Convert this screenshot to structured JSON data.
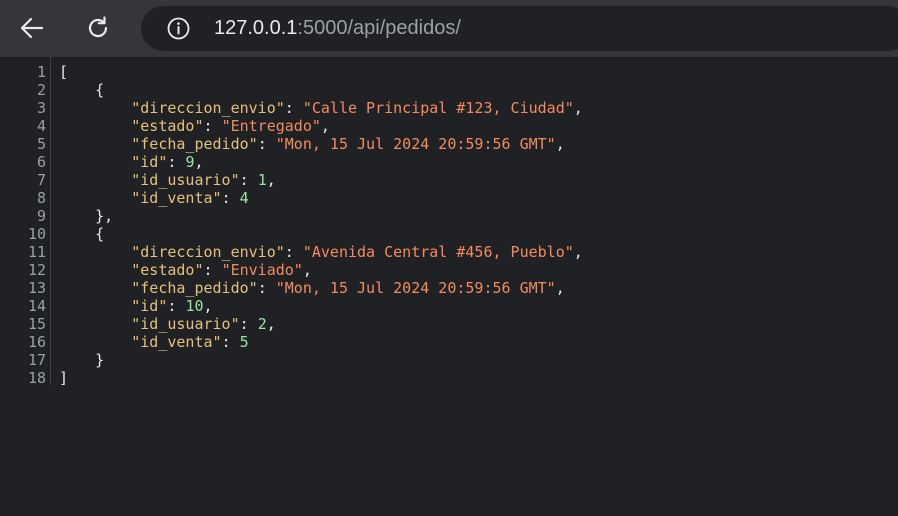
{
  "browser": {
    "url_host": "127.0.0.1",
    "url_path": ":5000/api/pedidos/"
  },
  "icons": {
    "back": "arrow-back-icon",
    "reload": "reload-icon",
    "info": "info-icon"
  },
  "colors": {
    "toolbar": "#35363a",
    "background": "#202124",
    "key": "#e5c07b",
    "string": "#f28b60",
    "number": "#98e6a5",
    "punctuation": "#e8eaed",
    "line_number": "#9aa0a6"
  },
  "code": {
    "lines": [
      {
        "n": "1",
        "indent": "",
        "tokens": [
          {
            "t": "[",
            "c": "p"
          }
        ]
      },
      {
        "n": "2",
        "indent": "    ",
        "tokens": [
          {
            "t": "{",
            "c": "p"
          }
        ]
      },
      {
        "n": "3",
        "indent": "        ",
        "tokens": [
          {
            "t": "\"direccion_envio\"",
            "c": "k"
          },
          {
            "t": ": ",
            "c": "p"
          },
          {
            "t": "\"Calle Principal #123, Ciudad\"",
            "c": "s"
          },
          {
            "t": ",",
            "c": "p"
          }
        ]
      },
      {
        "n": "4",
        "indent": "        ",
        "tokens": [
          {
            "t": "\"estado\"",
            "c": "k"
          },
          {
            "t": ": ",
            "c": "p"
          },
          {
            "t": "\"Entregado\"",
            "c": "s"
          },
          {
            "t": ",",
            "c": "p"
          }
        ]
      },
      {
        "n": "5",
        "indent": "        ",
        "tokens": [
          {
            "t": "\"fecha_pedido\"",
            "c": "k"
          },
          {
            "t": ": ",
            "c": "p"
          },
          {
            "t": "\"Mon, 15 Jul 2024 20:59:56 GMT\"",
            "c": "s"
          },
          {
            "t": ",",
            "c": "p"
          }
        ]
      },
      {
        "n": "6",
        "indent": "        ",
        "tokens": [
          {
            "t": "\"id\"",
            "c": "k"
          },
          {
            "t": ": ",
            "c": "p"
          },
          {
            "t": "9",
            "c": "n"
          },
          {
            "t": ",",
            "c": "p"
          }
        ]
      },
      {
        "n": "7",
        "indent": "        ",
        "tokens": [
          {
            "t": "\"id_usuario\"",
            "c": "k"
          },
          {
            "t": ": ",
            "c": "p"
          },
          {
            "t": "1",
            "c": "n"
          },
          {
            "t": ",",
            "c": "p"
          }
        ]
      },
      {
        "n": "8",
        "indent": "        ",
        "tokens": [
          {
            "t": "\"id_venta\"",
            "c": "k"
          },
          {
            "t": ": ",
            "c": "p"
          },
          {
            "t": "4",
            "c": "n"
          }
        ]
      },
      {
        "n": "9",
        "indent": "    ",
        "tokens": [
          {
            "t": "},",
            "c": "p"
          }
        ]
      },
      {
        "n": "10",
        "indent": "    ",
        "tokens": [
          {
            "t": "{",
            "c": "p"
          }
        ]
      },
      {
        "n": "11",
        "indent": "        ",
        "tokens": [
          {
            "t": "\"direccion_envio\"",
            "c": "k"
          },
          {
            "t": ": ",
            "c": "p"
          },
          {
            "t": "\"Avenida Central #456, Pueblo\"",
            "c": "s"
          },
          {
            "t": ",",
            "c": "p"
          }
        ]
      },
      {
        "n": "12",
        "indent": "        ",
        "tokens": [
          {
            "t": "\"estado\"",
            "c": "k"
          },
          {
            "t": ": ",
            "c": "p"
          },
          {
            "t": "\"Enviado\"",
            "c": "s"
          },
          {
            "t": ",",
            "c": "p"
          }
        ]
      },
      {
        "n": "13",
        "indent": "        ",
        "tokens": [
          {
            "t": "\"fecha_pedido\"",
            "c": "k"
          },
          {
            "t": ": ",
            "c": "p"
          },
          {
            "t": "\"Mon, 15 Jul 2024 20:59:56 GMT\"",
            "c": "s"
          },
          {
            "t": ",",
            "c": "p"
          }
        ]
      },
      {
        "n": "14",
        "indent": "        ",
        "tokens": [
          {
            "t": "\"id\"",
            "c": "k"
          },
          {
            "t": ": ",
            "c": "p"
          },
          {
            "t": "10",
            "c": "n"
          },
          {
            "t": ",",
            "c": "p"
          }
        ]
      },
      {
        "n": "15",
        "indent": "        ",
        "tokens": [
          {
            "t": "\"id_usuario\"",
            "c": "k"
          },
          {
            "t": ": ",
            "c": "p"
          },
          {
            "t": "2",
            "c": "n"
          },
          {
            "t": ",",
            "c": "p"
          }
        ]
      },
      {
        "n": "16",
        "indent": "        ",
        "tokens": [
          {
            "t": "\"id_venta\"",
            "c": "k"
          },
          {
            "t": ": ",
            "c": "p"
          },
          {
            "t": "5",
            "c": "n"
          }
        ]
      },
      {
        "n": "17",
        "indent": "    ",
        "tokens": [
          {
            "t": "}",
            "c": "p"
          }
        ]
      },
      {
        "n": "18",
        "indent": "",
        "tokens": [
          {
            "t": "]",
            "c": "p"
          }
        ]
      }
    ]
  }
}
